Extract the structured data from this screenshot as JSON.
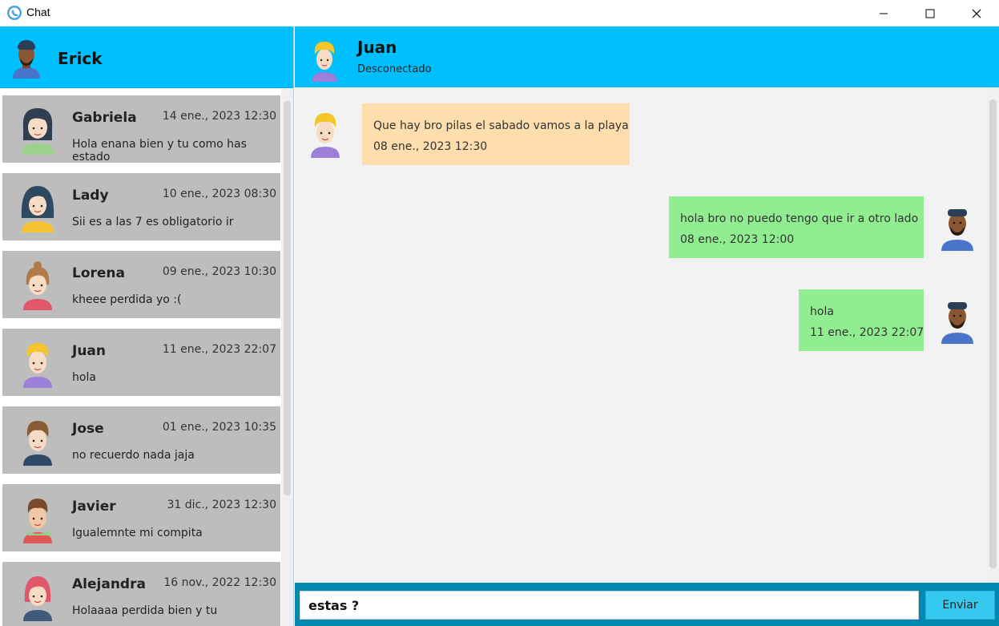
{
  "window": {
    "title": "Chat"
  },
  "current_user": {
    "name": "Erick"
  },
  "contacts": [
    {
      "name": "Gabriela",
      "date": "14 ene., 2023  12:30",
      "preview": "Hola enana bien y tu como has estado",
      "avatar": "woman-dark-hair-avatar"
    },
    {
      "name": "Lady",
      "date": "10 ene., 2023  08:30",
      "preview": "Sii es a las 7 es obligatorio ir",
      "avatar": "woman-long-hair-avatar"
    },
    {
      "name": "Lorena",
      "date": "09 ene., 2023  10:30",
      "preview": "kheee perdida yo :(",
      "avatar": "woman-bun-avatar"
    },
    {
      "name": "Juan",
      "date": "11 ene., 2023  22:07",
      "preview": "hola",
      "avatar": "blond-man-avatar"
    },
    {
      "name": "Jose",
      "date": "01 ene., 2023  10:35",
      "preview": "no recuerdo nada jaja",
      "avatar": "brown-hair-man-avatar"
    },
    {
      "name": "Javier",
      "date": "31 dic., 2023  12:30",
      "preview": "Igualemnte mi compita",
      "avatar": "scarf-man-avatar"
    },
    {
      "name": "Alejandra",
      "date": "16 nov., 2022  12:30",
      "preview": "Holaaaa perdida bien y tu",
      "avatar": "red-hair-woman-avatar"
    }
  ],
  "chat": {
    "name": "Juan",
    "status": "Desconectado",
    "messages": [
      {
        "direction": "in",
        "text": "Que hay bro pilas el sabado vamos a la playa",
        "time": "08 ene., 2023  12:30"
      },
      {
        "direction": "out",
        "text": "hola bro no puedo tengo que ir a otro lado",
        "time": "08 ene., 2023  12:00"
      },
      {
        "direction": "out",
        "text": "hola",
        "time": "11 ene., 2023  22:07"
      }
    ]
  },
  "compose": {
    "value": "estas ?",
    "send_label": "Enviar"
  },
  "colors": {
    "header": "#00bfff",
    "incoming": "#ffdead",
    "outgoing": "#90ee90",
    "compose_bar": "#0088b0",
    "send_button": "#35c9ef",
    "contact_bg": "#bdbdbd"
  }
}
